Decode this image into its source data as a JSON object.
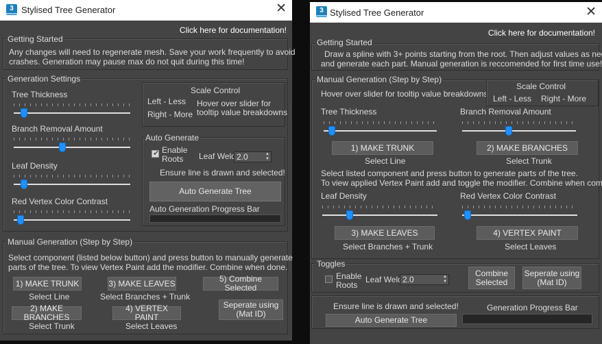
{
  "left": {
    "title": "Stylised Tree Generator",
    "icon_text": "3",
    "doc_link": "Click here for documentation!",
    "getting_started": {
      "label": "Getting Started",
      "line1": "Any changes will need to regenerate mesh. Save your work frequently to avoid",
      "line2": "crashes. Generation may pause max do not quit during this time!"
    },
    "generation": {
      "label": "Generation Settings",
      "tree_thickness": "Tree Thickness",
      "branch_removal": "Branch Removal Amount",
      "leaf_density": "Leaf Density",
      "red_vertex": "Red Vertex Color Contrast",
      "tree_thickness_value": 0.09,
      "branch_removal_value": 0.42,
      "leaf_density_value": 0.09,
      "red_vertex_value": 0.06
    },
    "scale": {
      "label": "Scale Control",
      "left": "Left - Less",
      "right": "Right - More",
      "hint1": "Hover over slider for",
      "hint2": "tooltip value breakdowns"
    },
    "auto": {
      "label": "Auto Generate",
      "enable1": "Enable",
      "enable2": "Roots",
      "leaf_weld": "Leaf Weld",
      "leaf_weld_value": "2.0",
      "ensure": "Ensure line is drawn and selected!",
      "button": "Auto Generate Tree",
      "progress_label": "Auto Generation Progress Bar"
    },
    "manual": {
      "label": "Manual Generation (Step by Step)",
      "line1": "Select component (listed below button) and press button to manually generate",
      "line2": "parts of the tree. To view Vertex Paint add the modifier. Combine when done.",
      "make_trunk": "1) MAKE TRUNK",
      "make_trunk_sub": "Select Line",
      "make_leaves": "3) MAKE LEAVES",
      "make_leaves_sub": "Select Branches + Trunk",
      "combine": "5) Combine Selected",
      "make_branches": "2) MAKE BRANCHES",
      "make_branches_sub": "Select Trunk",
      "vertex_paint": "4) VERTEX PAINT",
      "vertex_paint_sub": "Select Leaves",
      "seperate1": "Seperate using",
      "seperate2": "(Mat ID)"
    }
  },
  "right": {
    "title": "Stylised Tree Generator",
    "icon_text": "3",
    "doc_link": "Click here for documentation!",
    "getting_started": {
      "label": "Getting Started",
      "line1": "Draw a spline with 3+ points starting from the root. Then adjust values as needed",
      "line2": "and generate each part. Manual generation is reccomended for first time use!"
    },
    "manual": {
      "label": "Manual Generation (Step by Step)",
      "hover": "Hover over slider for tooltip value breakdowns",
      "scale_label": "Scale Control",
      "scale_left": "Left - Less",
      "scale_right": "Right - More",
      "tree_thickness": "Tree Thickness",
      "branch_removal": "Branch Removal Amount",
      "tree_thickness_value": 0.07,
      "branch_removal_value": 0.41,
      "make_trunk": "1) MAKE TRUNK",
      "make_trunk_sub": "Select Line",
      "make_branches": "2) MAKE BRANCHES",
      "make_branches_sub": "Select Trunk",
      "info1": "Select listed component and press button to generate parts of the tree.",
      "info2": "To view applied Vertex Paint add and toggle the modifier. Combine when complete.",
      "leaf_density": "Leaf Density",
      "red_vertex": "Red Vertex Color Contrast",
      "leaf_density_value": 0.24,
      "red_vertex_value": 0.05,
      "make_leaves": "3) MAKE LEAVES",
      "make_leaves_sub": "Select Branches + Trunk",
      "vertex_paint": "4) VERTEX PAINT",
      "vertex_paint_sub": "Select Leaves"
    },
    "toggles": {
      "label": "Toggles",
      "enable1": "Enable",
      "enable2": "Roots",
      "leaf_weld": "Leaf Weld",
      "leaf_weld_value": "2.0",
      "combine1": "Combine",
      "combine2": "Selected",
      "seperate1": "Seperate using",
      "seperate2": "(Mat ID)"
    },
    "auto": {
      "ensure": "Ensure line is drawn and selected!",
      "button": "Auto Generate Tree",
      "progress_label": "Generation Progress Bar"
    }
  }
}
